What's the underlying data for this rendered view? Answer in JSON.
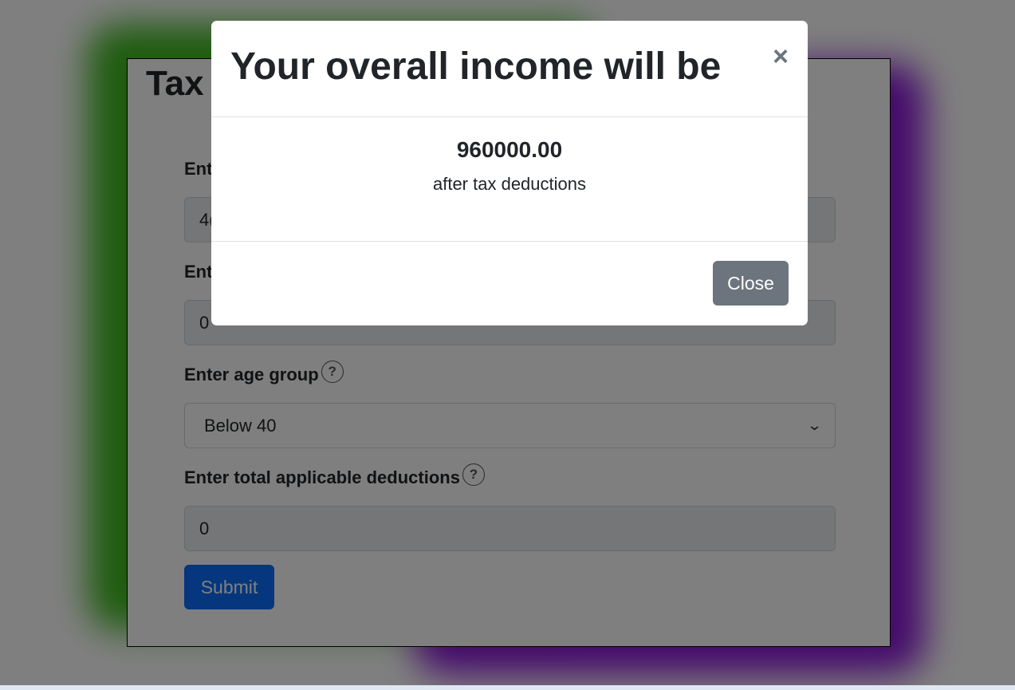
{
  "card": {
    "title": "Tax"
  },
  "form": {
    "fields": [
      {
        "label": "Ent",
        "value": "4("
      },
      {
        "label": "Ent",
        "value": "0"
      },
      {
        "label": "Enter age group",
        "help": "?",
        "value": "Below 40"
      },
      {
        "label": "Enter total applicable deductions",
        "help": "?",
        "value": "0"
      }
    ],
    "submit_label": "Submit"
  },
  "modal": {
    "title": "Your overall income will be",
    "close_symbol": "×",
    "amount": "960000.00",
    "note": "after tax deductions",
    "close_label": "Close"
  },
  "colors": {
    "primary": "#0d6efd",
    "secondary": "#6c757d",
    "glow_green": "#3fb91f",
    "glow_purple": "#8a14d6"
  },
  "icons": {
    "help": "question-circle-icon",
    "close": "close-icon",
    "select": "chevron-down-icon"
  }
}
